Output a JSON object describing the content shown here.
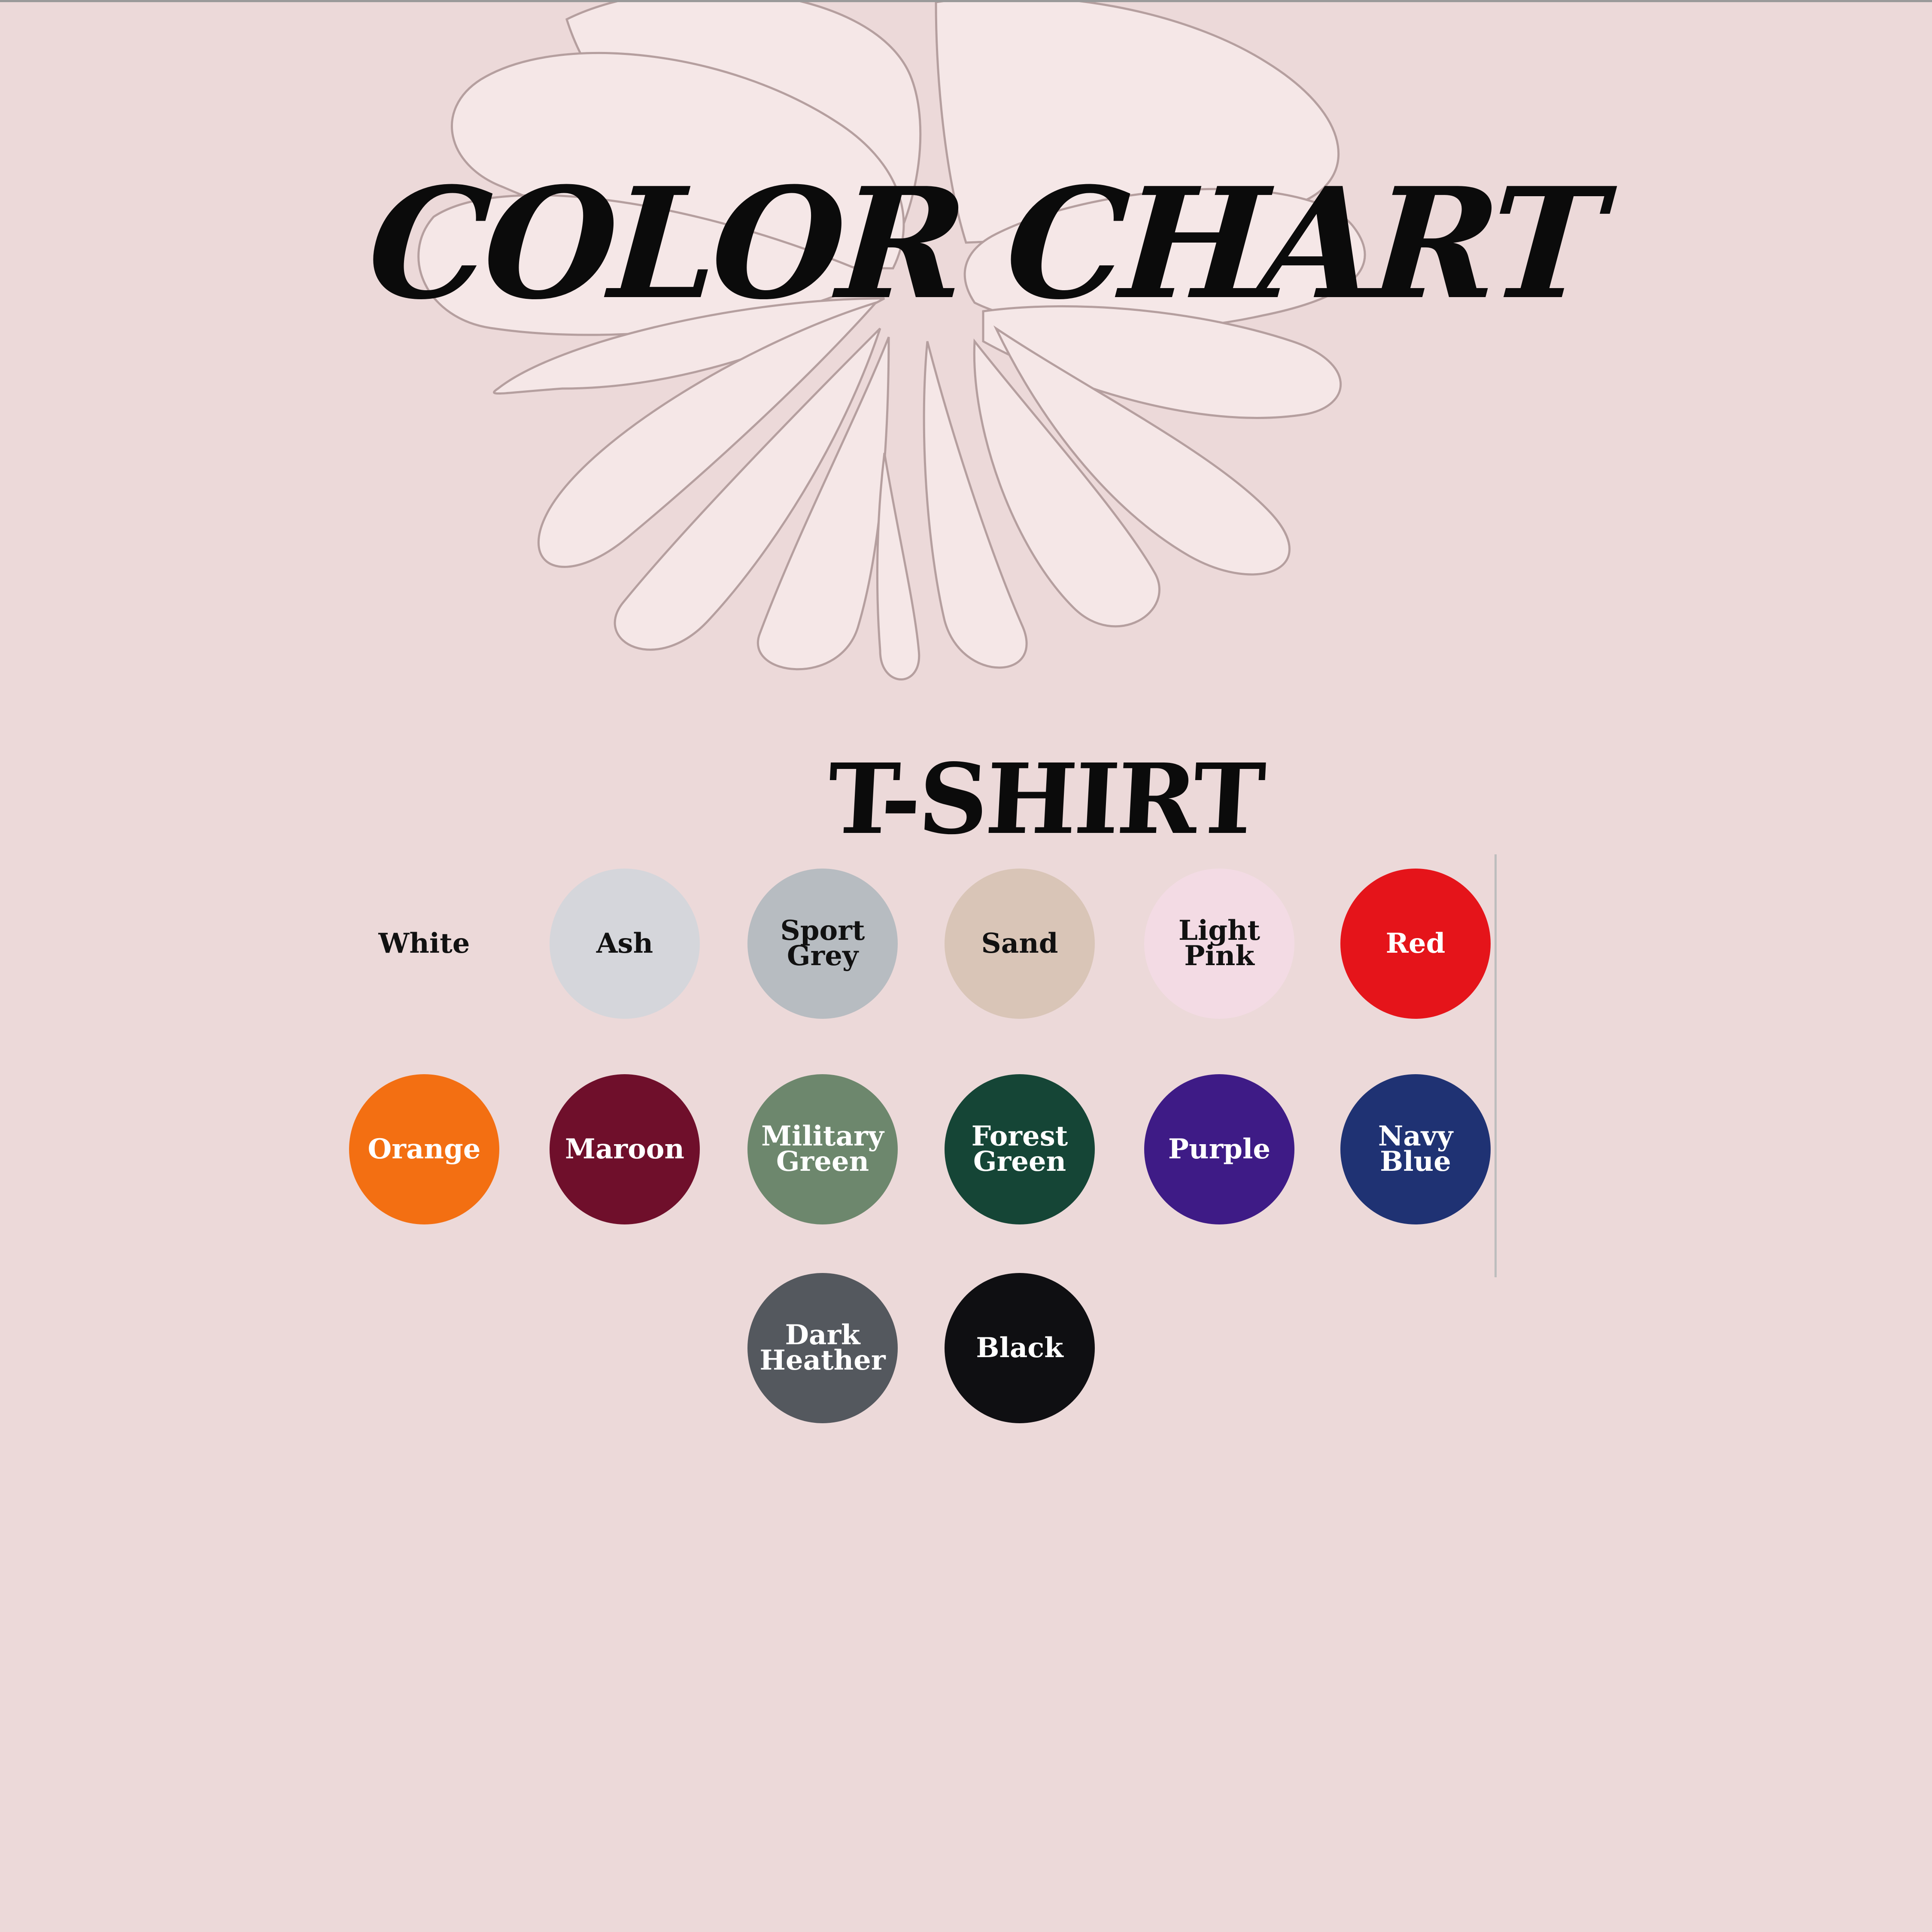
{
  "title": "COLOR CHART",
  "subtitle": "T-SHIRT",
  "colors": {
    "background": "#ecd9d9",
    "flower_fill": "#f5e7e7",
    "flower_stroke": "#b59f9f"
  },
  "swatches": [
    {
      "label": "White",
      "color": "#ecd9d9",
      "text_color": "#111111"
    },
    {
      "label": "Ash",
      "color": "#d5d6db",
      "text_color": "#111111"
    },
    {
      "label": "Sport\nGrey",
      "color": "#b7bcc1",
      "text_color": "#111111"
    },
    {
      "label": "Sand",
      "color": "#d9c5b7",
      "text_color": "#111111"
    },
    {
      "label": "Light\nPink",
      "color": "#f3dbe4",
      "text_color": "#111111"
    },
    {
      "label": "Red",
      "color": "#e5141a",
      "text_color": "#ffffff"
    },
    {
      "label": "Orange",
      "color": "#f36f12",
      "text_color": "#ffffff"
    },
    {
      "label": "Maroon",
      "color": "#6f0f2b",
      "text_color": "#ffffff"
    },
    {
      "label": "Military\nGreen",
      "color": "#6d876d",
      "text_color": "#ffffff"
    },
    {
      "label": "Forest\nGreen",
      "color": "#154536",
      "text_color": "#ffffff"
    },
    {
      "label": "Purple",
      "color": "#3e1b86",
      "text_color": "#ffffff"
    },
    {
      "label": "Navy\nBlue",
      "color": "#1f3273",
      "text_color": "#ffffff"
    },
    {
      "label": "Dark\nHeather",
      "color": "#54585e",
      "text_color": "#ffffff"
    },
    {
      "label": "Black",
      "color": "#0f0f12",
      "text_color": "#ffffff"
    }
  ]
}
